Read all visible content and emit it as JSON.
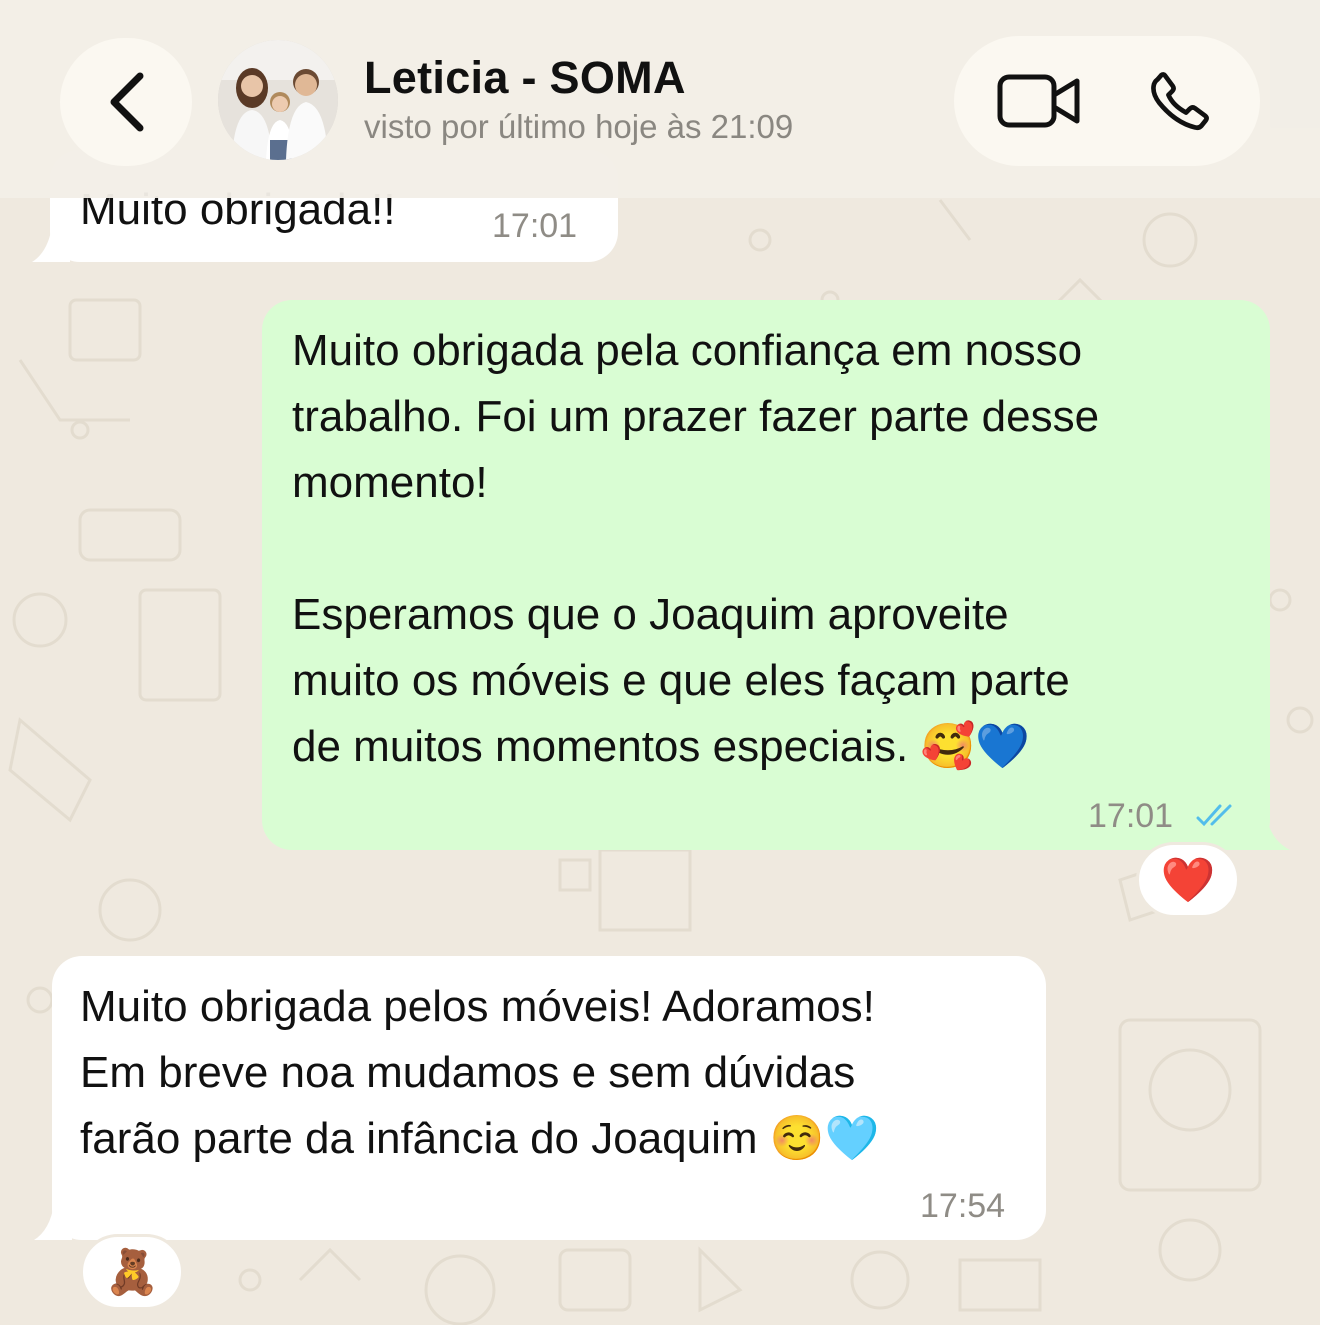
{
  "header": {
    "contact_name": "Leticia - SOMA",
    "last_seen": "visto por último hoje às 21:09",
    "icons": {
      "back": "chevron-left-icon",
      "video": "video-call-icon",
      "phone": "phone-call-icon"
    }
  },
  "messages": [
    {
      "direction": "incoming",
      "text": "Muito obrigada!!",
      "time": "17:01"
    },
    {
      "direction": "outgoing",
      "text": "Muito obrigada pela confiança em nosso\ntrabalho. Foi um prazer fazer parte desse\nmomento!\n\nEsperamos que o Joaquim aproveite\nmuito os móveis e que eles façam parte\nde muitos momentos especiais. 🥰💙",
      "time": "17:01",
      "status": "read",
      "reaction": "❤️"
    },
    {
      "direction": "incoming",
      "text": "Muito obrigada pelos móveis! Adoramos!\nEm breve noa mudamos e sem dúvidas\nfarão parte da infância do Joaquim ☺️🩵",
      "time": "17:54",
      "reaction": "🧸"
    }
  ],
  "colors": {
    "wallpaper": "#efe9df",
    "outgoing_bubble": "#d9fdd3",
    "incoming_bubble": "#ffffff",
    "read_ticks": "#53bdeb",
    "timestamp": "#8f8c86"
  }
}
